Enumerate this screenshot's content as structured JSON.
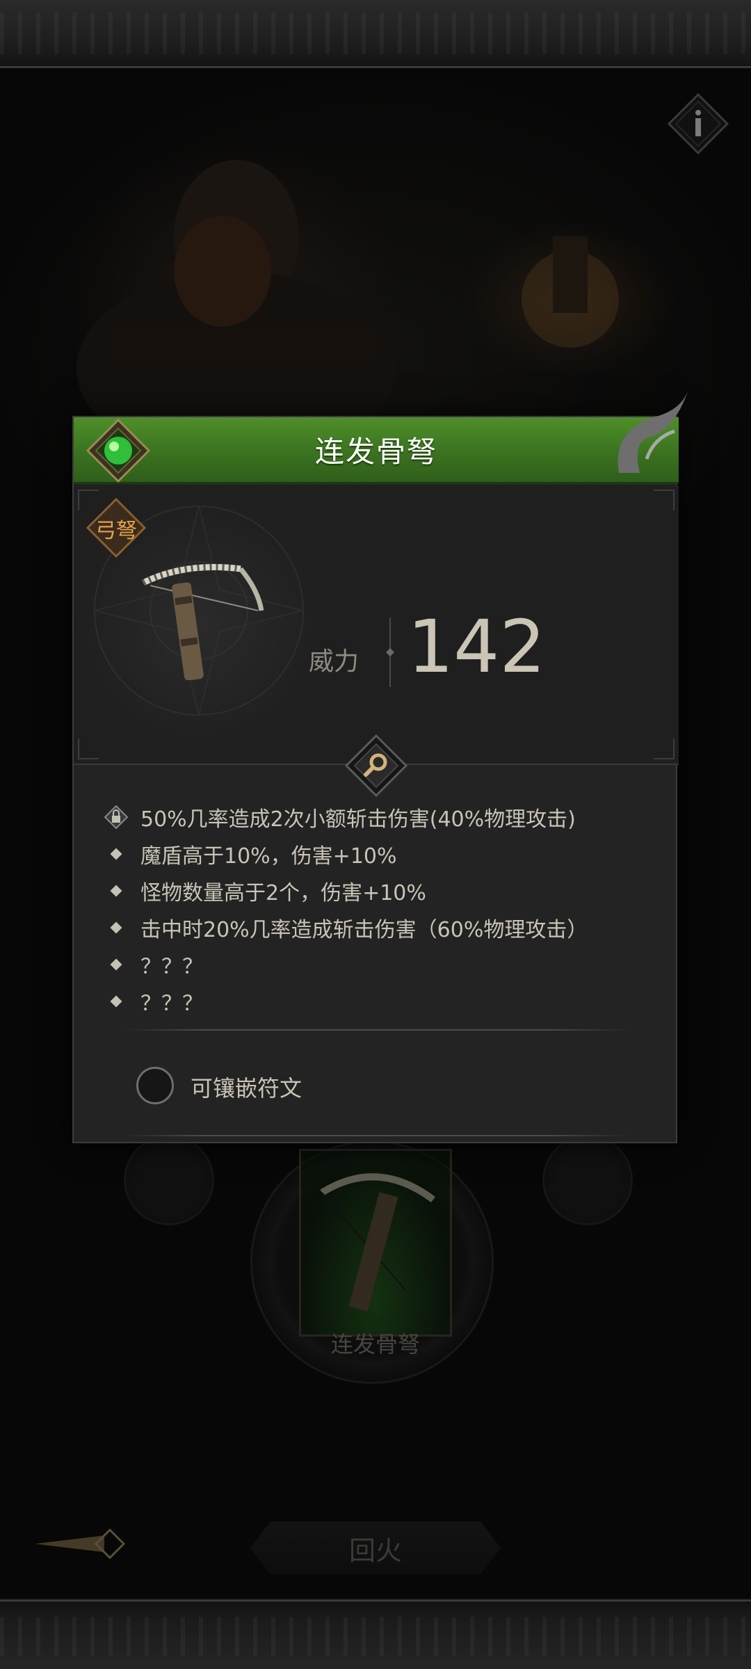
{
  "popup": {
    "title": "连发骨弩",
    "weapon_type": "弓弩",
    "power_label": "威力",
    "power_value": "142",
    "attributes": [
      {
        "icon": "lock-icon",
        "text": "50%几率造成2次小额斩击伤害(40%物理攻击)"
      },
      {
        "icon": "diamond-bullet-icon",
        "text": "魔盾高于10%，伤害+10%"
      },
      {
        "icon": "diamond-bullet-icon",
        "text": "怪物数量高于2个，伤害+10%"
      },
      {
        "icon": "diamond-bullet-icon",
        "text": "击中时20%几率造成斩击伤害（60%物理攻击）"
      },
      {
        "icon": "diamond-bullet-icon",
        "text": "？？？"
      },
      {
        "icon": "diamond-bullet-icon",
        "text": "？？？"
      }
    ],
    "rune_toggle_label": "可镶嵌符文",
    "rune_toggle_checked": false
  },
  "background": {
    "item_name": "连发骨弩",
    "fire_button_label": "回火"
  },
  "colors": {
    "header_green": "#3c7521",
    "badge_orange": "#e3a24c",
    "text": "#c9c4b6"
  }
}
